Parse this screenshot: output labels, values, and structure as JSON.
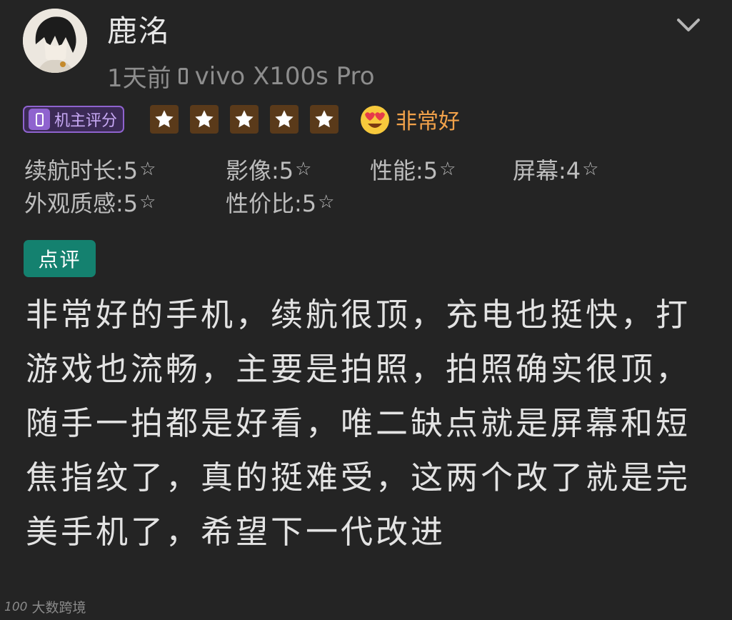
{
  "user": {
    "name": "鹿洺",
    "time_ago": "1天前",
    "device": "vivo X100s Pro"
  },
  "rating": {
    "badge_label": "机主评分",
    "stars": 5,
    "max_stars": 5,
    "verdict": "非常好",
    "star_color": "#f5b94a",
    "badge_color": "#8f63cf",
    "verdict_color": "#f2a24a"
  },
  "subscores": [
    {
      "label": "续航时长:5",
      "score": 5,
      "icon": "star-outline-icon"
    },
    {
      "label": "影像:5",
      "score": 5,
      "icon": "star-outline-icon"
    },
    {
      "label": "性能:5",
      "score": 5,
      "icon": "star-outline-icon"
    },
    {
      "label": "屏幕:4",
      "score": 4,
      "icon": "star-outline-icon"
    },
    {
      "label": "外观质感:5",
      "score": 5,
      "icon": "star-outline-icon"
    },
    {
      "label": "性价比:5",
      "score": 5,
      "icon": "star-outline-icon"
    }
  ],
  "review": {
    "tag": "点评",
    "tag_color": "#14816f",
    "text": "非常好的手机，续航很顶，充电也挺快，打游戏也流畅，主要是拍照，拍照确实很顶，随手一拍都是好看，唯二缺点就是屏幕和短焦指纹了，真的挺难受，这两个改了就是完美手机了，希望下一代改进"
  },
  "watermark": {
    "logo": "100",
    "text": "大数跨境"
  }
}
